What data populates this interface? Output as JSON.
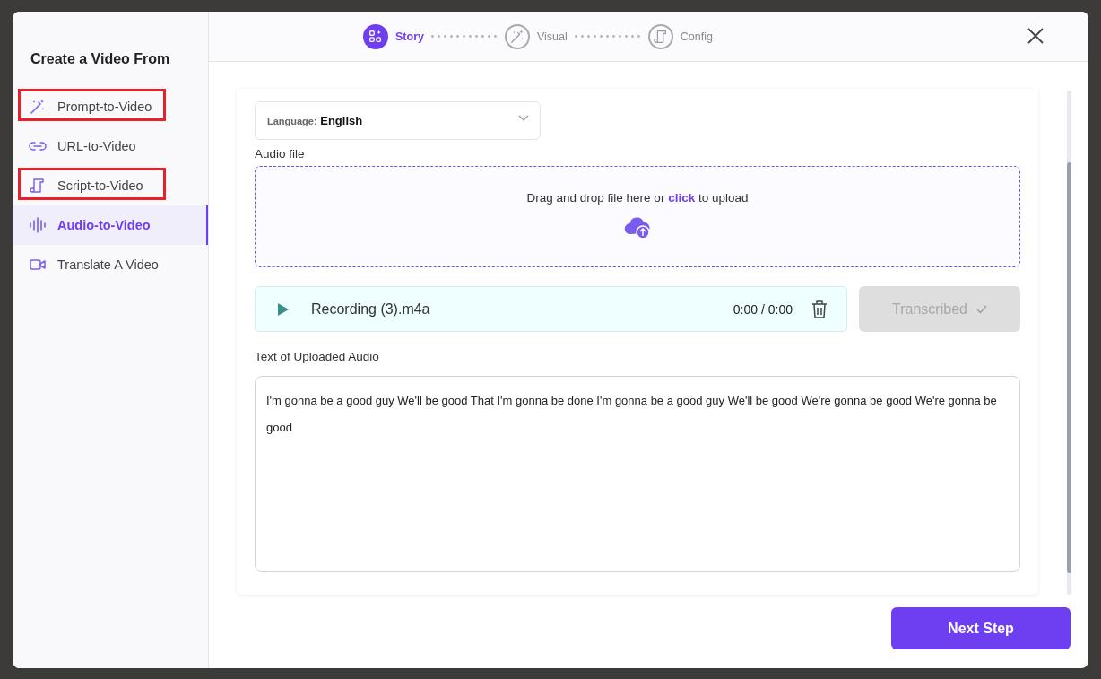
{
  "sidebar": {
    "title": "Create a Video From",
    "items": [
      {
        "label": "Prompt-to-Video",
        "selected": false,
        "highlighted": true
      },
      {
        "label": "URL-to-Video",
        "selected": false,
        "highlighted": false
      },
      {
        "label": "Script-to-Video",
        "selected": false,
        "highlighted": true
      },
      {
        "label": "Audio-to-Video",
        "selected": true,
        "highlighted": false
      },
      {
        "label": "Translate A Video",
        "selected": false,
        "highlighted": false
      }
    ]
  },
  "steps": [
    {
      "label": "Story",
      "selected": true
    },
    {
      "label": "Visual",
      "selected": false
    },
    {
      "label": "Config",
      "selected": false
    }
  ],
  "form": {
    "language": {
      "label": "Language:",
      "value": "English"
    },
    "audio_label": "Audio file",
    "dropzone": {
      "text": "Drag and drop file here or **click** to upload"
    },
    "recording": {
      "name": "Recording (3).m4a",
      "time": "0:00 / 0:00"
    },
    "transcribe_button": {
      "label": "Transcribed",
      "disabled": true
    },
    "text_label": "Text of Uploaded Audio",
    "transcript": "I'm gonna be a good guy We'll be good That I'm gonna be done I'm gonna be a good guy We'll be good We're gonna be good We're gonna be good"
  },
  "next_button": "Next Step"
}
